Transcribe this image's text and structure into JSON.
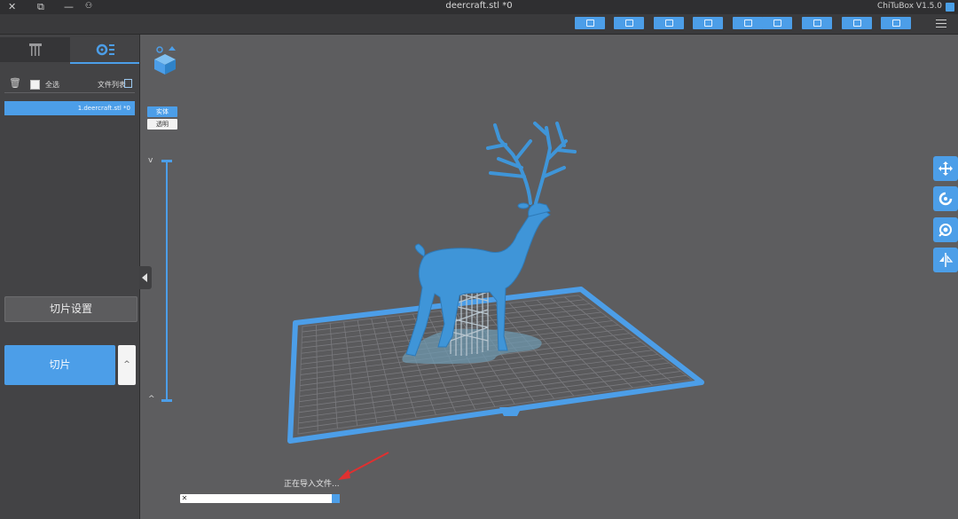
{
  "window": {
    "title": "deercraft.stl *0",
    "app_name": "ChiTuBox V1.5.0",
    "accent_color": "#4c9ee8",
    "icons": [
      "close-icon",
      "restore-icon",
      "minimize-icon",
      "user-icon",
      "app-icon"
    ]
  },
  "toolbar": {
    "buttons": [
      "add-icon",
      "home-icon",
      "hierarchy-icon",
      "copy-icon",
      "import-icon",
      "export-icon",
      "save-icon",
      "open-icon",
      "print-icon"
    ],
    "menu_icon": "menu-icon"
  },
  "left_panel": {
    "tabs": [
      "objects",
      "supports"
    ],
    "file_list_label": "文件列表",
    "select_all_label": "全选",
    "file_items": [
      "1.deercraft.stl *0"
    ],
    "settings_button": "切片设置",
    "slice_button": "切片",
    "slice_more": "^"
  },
  "viewport": {
    "view_modes": [
      "实体",
      "透明"
    ],
    "active_view_mode": "实体",
    "layer_up": "^",
    "layer_down": "v",
    "side_tools": [
      "move-icon",
      "rotate-icon",
      "scale-icon",
      "mirror-icon"
    ]
  },
  "progress": {
    "label": "正在导入文件...",
    "value": 0.05
  }
}
